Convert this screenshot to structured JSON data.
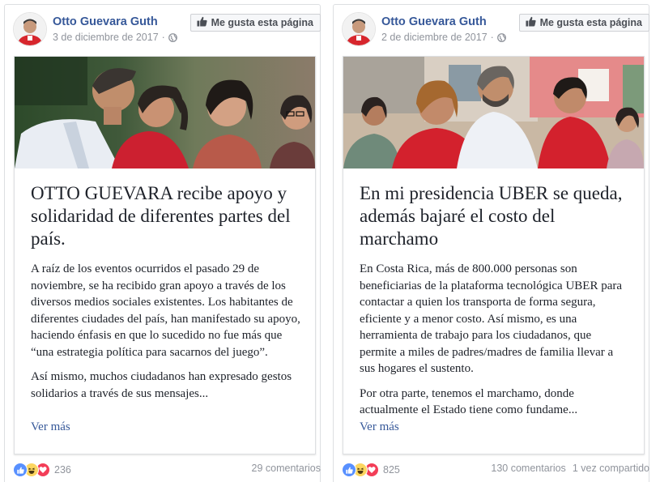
{
  "posts": [
    {
      "author": "Otto Guevara Guth",
      "date": "3 de diciembre de 2017",
      "separator": "·",
      "like_page_label": "Me gusta esta página",
      "title": "OTTO GUEVARA recibe apoyo y solidaridad de diferentes partes del país.",
      "paragraphs": [
        "A raíz de los eventos ocurridos el pasado 29 de noviembre, se ha recibido gran apoyo a través de los diversos medios sociales existentes. Los habitantes de diferentes ciudades del país, han manifestado su apoyo, haciendo énfasis en que lo sucedido no fue más que “una estrategia política para sacarnos del juego”.",
        "Así mismo, muchos ciudadanos han expresado gestos solidarios a través de sus mensajes..."
      ],
      "see_more": "Ver más",
      "reactions": [
        "like-icon",
        "haha-icon",
        "love-icon"
      ],
      "reaction_count": "236",
      "comments": "29 comentarios",
      "shares": ""
    },
    {
      "author": "Otto Guevara Guth",
      "date": "2 de diciembre de 2017",
      "separator": "·",
      "like_page_label": "Me gusta esta página",
      "title": "En mi presidencia UBER se queda, además bajaré el costo del marchamo",
      "paragraphs": [
        "En Costa Rica, más de 800.000 personas son beneficiarias de la plataforma tecnológica UBER para contactar a quien los transporta de forma segura, eficiente y a menor costo. Así mismo, es una herramienta de trabajo para los ciudadanos, que permite a miles de padres/madres de familia llevar a sus hogares el sustento.",
        "Por otra parte, tenemos el marchamo, donde actualmente el Estado tiene como fundame..."
      ],
      "see_more": "Ver más",
      "reactions": [
        "like-icon",
        "haha-icon",
        "love-icon"
      ],
      "reaction_count": "825",
      "comments": "130 comentarios",
      "shares": "1 vez compartido"
    }
  ],
  "colors": {
    "link": "#365899",
    "muted": "#90949c",
    "text": "#1d2129",
    "border": "#dddfe2",
    "like_blue": "#3b82f6",
    "love_red": "#f33e58",
    "haha_yellow": "#fcd660"
  }
}
